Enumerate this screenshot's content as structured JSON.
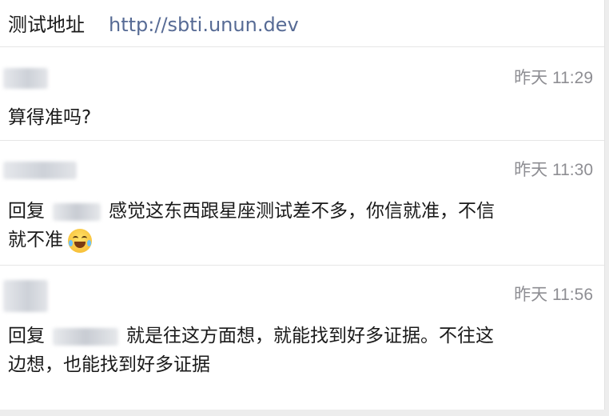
{
  "header": {
    "label": "测试地址",
    "link": "http://sbti.unun.dev"
  },
  "comments": [
    {
      "time": "昨天 11:29",
      "text": "算得准吗?"
    },
    {
      "time": "昨天 11:30",
      "reply_prefix": "回复",
      "line1": "感觉这东西跟星座测试差不多，你信就准，不信",
      "line2": "就不准",
      "emoji": "laughing-tears-emoji"
    },
    {
      "time": "昨天 11:56",
      "reply_prefix": "回复",
      "line1": "就是往这方面想，就能找到好多证据。不往这",
      "line2": "边想，也能找到好多证据"
    }
  ],
  "colors": {
    "link": "#576b95",
    "timestamp": "#8e8e93",
    "divider": "#e6e6e6"
  }
}
